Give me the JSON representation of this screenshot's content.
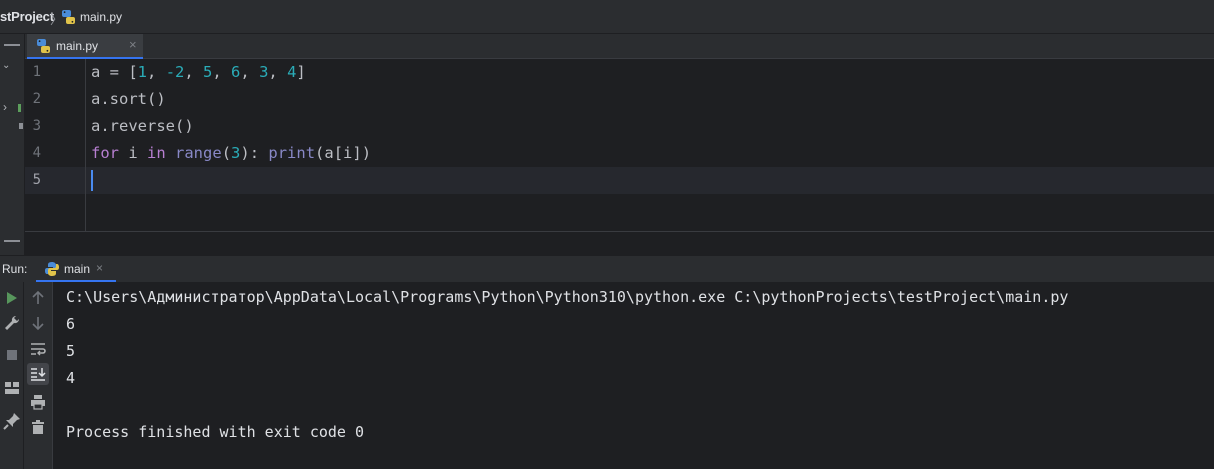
{
  "breadcrumb": {
    "project": "stProject",
    "file": "main.py"
  },
  "tabs": [
    {
      "label": "main.py",
      "close": "×"
    }
  ],
  "editor": {
    "line_numbers": [
      "1",
      "2",
      "3",
      "4",
      "5"
    ],
    "code": {
      "l1": {
        "a": "a = [",
        "n1": "1",
        "s1": ", ",
        "n2": "-2",
        "s2": ", ",
        "n3": "5",
        "s3": ", ",
        "n4": "6",
        "s4": ", ",
        "n5": "3",
        "s5": ", ",
        "n6": "4",
        "end": "]"
      },
      "l2": "a.sort()",
      "l3": "a.reverse()",
      "l4": {
        "for": "for",
        "i": " i ",
        "in": "in",
        "sp": " ",
        "range": "range",
        "open": "(",
        "three": "3",
        "close": "): ",
        "print": "print",
        "args": "(a[i])"
      },
      "l5": ""
    }
  },
  "run": {
    "label": "Run:",
    "tab": {
      "label": "main",
      "close": "×"
    },
    "console": [
      "C:\\Users\\Администратор\\AppData\\Local\\Programs\\Python\\Python310\\python.exe C:\\pythonProjects\\testProject\\main.py",
      "6",
      "5",
      "4",
      "",
      "Process finished with exit code 0"
    ]
  },
  "icons": {
    "python_file": "python-file-icon",
    "run": "run-icon",
    "wrench": "wrench-icon",
    "stop": "stop-icon",
    "layout": "layout-icon",
    "pin": "pin-icon",
    "up": "arrow-up-icon",
    "down": "arrow-down-icon",
    "soft_wrap": "soft-wrap-icon",
    "scroll_end": "scroll-to-end-icon",
    "print": "print-icon",
    "trash": "trash-icon"
  },
  "colors": {
    "accent": "#3574f0",
    "run_green": "#57965c",
    "number": "#2aacb8",
    "keyword": "#cf8e6d",
    "builtin": "#8888c6"
  }
}
